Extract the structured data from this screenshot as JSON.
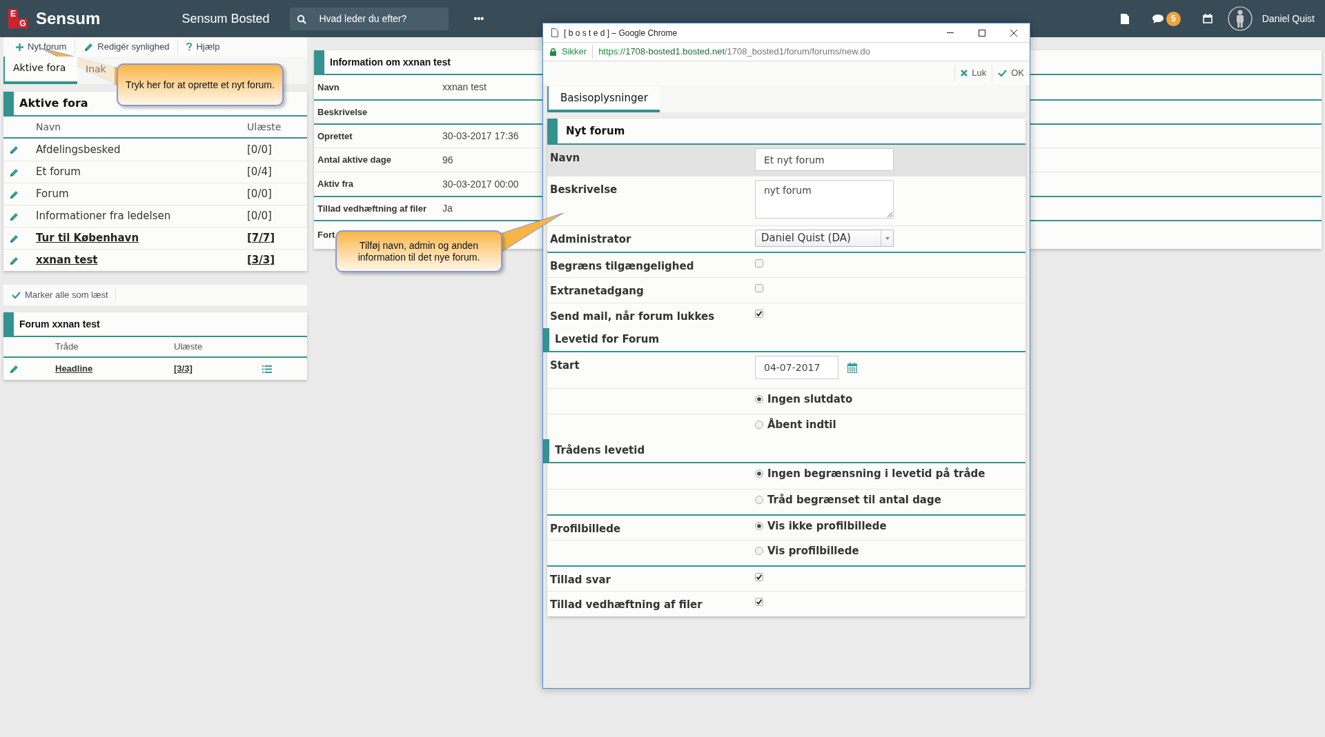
{
  "topbar": {
    "logo_letters": [
      "E",
      "G"
    ],
    "logo_text": "Sensum",
    "app_title": "Sensum Bosted",
    "search": {
      "placeholder": "Hvad leder du efter?"
    },
    "more": "•••",
    "messages_badge": "5",
    "user_name": "Daniel Quist"
  },
  "left_toolbar": [
    {
      "kind": "add",
      "label": "Nyt forum"
    },
    {
      "kind": "edit",
      "label": "Redigér synlighed"
    },
    {
      "kind": "help",
      "label": "Hjælp"
    }
  ],
  "left_tabs": [
    {
      "label": "Aktive fora",
      "selected": true
    },
    {
      "label": "Inak",
      "selected": false
    }
  ],
  "active_forums": {
    "title": "Aktive fora",
    "columns": [
      "Navn",
      "Ulæste"
    ],
    "rows": [
      {
        "name": "Afdelingsbesked",
        "unread_count": "[0/0]",
        "unread": false
      },
      {
        "name": "Et forum",
        "unread_count": "[0/4]",
        "unread": false
      },
      {
        "name": "Forum",
        "unread_count": "[0/0]",
        "unread": false
      },
      {
        "name": "Informationer fra ledelsen",
        "unread_count": "[0/0]",
        "unread": false
      },
      {
        "name": "Tur til København",
        "unread_count": "[7/7]",
        "unread": true
      },
      {
        "name": "xxnan test",
        "unread_count": "[3/3]",
        "unread": true
      }
    ]
  },
  "mark_all_read": "Marker alle som læst",
  "forum_panel": {
    "title": "Forum xxnan test",
    "columns": [
      "Tråde",
      "Ulæste"
    ],
    "rows": [
      {
        "name": "Headline",
        "unread_count": "[3/3]"
      }
    ]
  },
  "info_panel": {
    "title": "Information om xxnan test",
    "groups": [
      [
        {
          "label": "Navn",
          "value": "xxnan test"
        }
      ],
      [
        {
          "label": "Beskrivelse"
        }
      ],
      [
        {
          "label": "Oprettet",
          "value": "30-03-2017 17:36"
        },
        {
          "label": "Antal aktive dage",
          "value": "96"
        },
        {
          "label": "Aktiv fra",
          "value": "30-03-2017 00:00"
        }
      ],
      [
        {
          "label": "Tillad vedhæftning af filer",
          "value": "Ja"
        }
      ],
      [
        {
          "label": "Fort"
        }
      ]
    ]
  },
  "callouts": [
    {
      "text": "Tryk her for at oprette et nyt forum."
    },
    {
      "text": "Tilføj navn, admin og anden information til det nye forum."
    }
  ],
  "popup": {
    "window_title": "[ b o s t e d ] – Google Chrome",
    "secure_label": "Sikker",
    "url_scheme": "https://",
    "url_host": "1708-bosted1.bosted.net",
    "url_path": "/1708_bosted1/forum/forums/new.do",
    "actions": [
      {
        "kind": "close",
        "label": "Luk"
      },
      {
        "kind": "ok",
        "label": "OK"
      }
    ],
    "tabs": [
      {
        "label": "Basisoplysninger",
        "selected": true
      }
    ],
    "form": {
      "title": "Nyt forum",
      "groups": [
        {
          "rows": [
            {
              "kind": "text",
              "label": "Navn",
              "value": "Et nyt forum",
              "highlighted": true
            },
            {
              "kind": "textarea",
              "label": "Beskrivelse",
              "value": "nyt forum",
              "highlighted": false
            },
            {
              "kind": "select",
              "label": "Administrator",
              "value": "Daniel Quist (DA)",
              "highlighted": false
            }
          ]
        },
        {
          "rows": [
            {
              "kind": "checkbox",
              "label": "Begræns tilgængelighed",
              "checked": false
            },
            {
              "kind": "checkbox",
              "label": "Extranetadgang",
              "checked": false
            },
            {
              "kind": "checkbox",
              "label": "Send mail, når forum lukkes",
              "checked": true
            }
          ]
        },
        {
          "title": "Levetid for Forum",
          "rows": [
            {
              "kind": "date",
              "label": "Start",
              "value": "04-07-2017"
            },
            {
              "kind": "radio",
              "option": "Ingen slutdato",
              "selected": true
            },
            {
              "kind": "radio",
              "option": "Åbent indtil",
              "selected": false
            }
          ]
        },
        {
          "title": "Trådens levetid",
          "rows": [
            {
              "kind": "radio",
              "option": "Ingen begrænsning i levetid på tråde",
              "selected": true
            },
            {
              "kind": "radio",
              "option": "Tråd begrænset til antal dage",
              "selected": false
            }
          ]
        },
        {
          "rows": [
            {
              "kind": "radio",
              "label": "Profilbillede",
              "option": "Vis ikke profilbillede",
              "selected": true
            },
            {
              "kind": "radio",
              "option": "Vis profilbillede",
              "selected": false
            }
          ]
        },
        {
          "rows": [
            {
              "kind": "checkbox",
              "label": "Tillad svar",
              "checked": true
            },
            {
              "kind": "checkbox",
              "label": "Tillad vedhæftning af filer",
              "checked": true
            }
          ]
        }
      ]
    }
  }
}
